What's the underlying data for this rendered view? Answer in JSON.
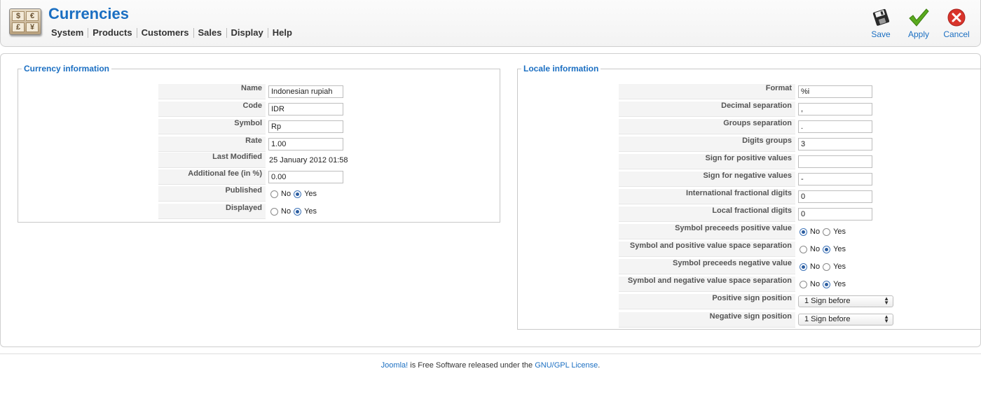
{
  "header": {
    "title": "Currencies",
    "logo_letters": [
      "$",
      "€",
      "£",
      "¥"
    ],
    "menu": [
      {
        "label": "System"
      },
      {
        "label": "Products"
      },
      {
        "label": "Customers"
      },
      {
        "label": "Sales"
      },
      {
        "label": "Display"
      },
      {
        "label": "Help"
      }
    ],
    "toolbar": {
      "save_label": "Save",
      "apply_label": "Apply",
      "cancel_label": "Cancel"
    }
  },
  "currency": {
    "legend": "Currency information",
    "name_label": "Name",
    "name_value": "Indonesian rupiah",
    "code_label": "Code",
    "code_value": "IDR",
    "symbol_label": "Symbol",
    "symbol_value": "Rp",
    "rate_label": "Rate",
    "rate_value": "1.00",
    "last_modified_label": "Last Modified",
    "last_modified_value": "25 January 2012 01:58",
    "fee_label": "Additional fee (in %)",
    "fee_value": "0.00",
    "published_label": "Published",
    "published": "Yes",
    "displayed_label": "Displayed",
    "displayed": "Yes"
  },
  "locale": {
    "legend": "Locale information",
    "format_label": "Format",
    "format_value": "%i",
    "decimal_label": "Decimal separation",
    "decimal_value": ",",
    "groups_label": "Groups separation",
    "groups_value": ".",
    "digits_groups_label": "Digits groups",
    "digits_groups_value": "3",
    "sign_positive_label": "Sign for positive values",
    "sign_positive_value": "",
    "sign_negative_label": "Sign for negative values",
    "sign_negative_value": "-",
    "intl_frac_label": "International fractional digits",
    "intl_frac_value": "0",
    "local_frac_label": "Local fractional digits",
    "local_frac_value": "0",
    "sym_pre_pos_label": "Symbol preceeds positive value",
    "sym_pre_pos": "No",
    "sym_pos_space_label": "Symbol and positive value space separation",
    "sym_pos_space": "Yes",
    "sym_pre_neg_label": "Symbol preceeds negative value",
    "sym_pre_neg": "No",
    "sym_neg_space_label": "Symbol and negative value space separation",
    "sym_neg_space": "Yes",
    "pos_sign_pos_label": "Positive sign position",
    "pos_sign_pos_value": "1 Sign before",
    "neg_sign_pos_label": "Negative sign position",
    "neg_sign_pos_value": "1 Sign before"
  },
  "radio_labels": {
    "no": "No",
    "yes": "Yes"
  },
  "footer": {
    "link1": "Joomla!",
    "text": " is Free Software released under the ",
    "link2": "GNU/GPL License",
    "end": "."
  },
  "colors": {
    "accent": "#1b6fc2",
    "apply_green": "#5aaa1e",
    "cancel_red": "#d9342b"
  }
}
